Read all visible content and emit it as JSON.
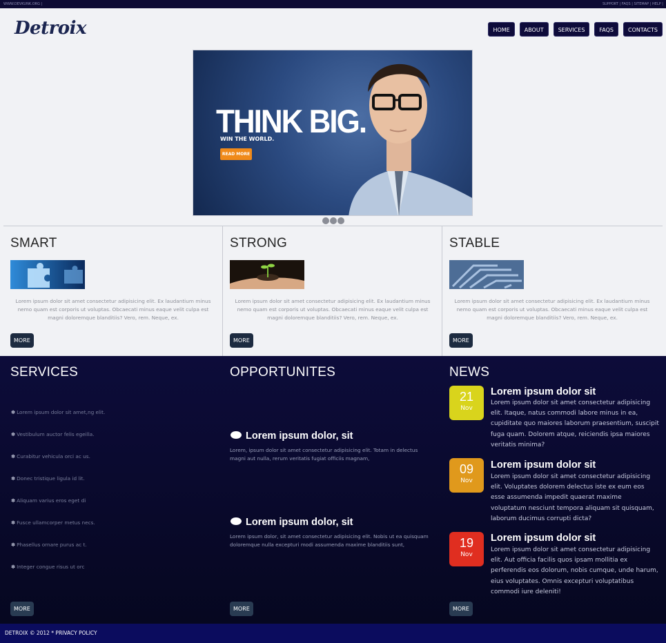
{
  "topbar": {
    "left": "WWW.DEVKUNK.ORG |",
    "right": "SUPPORT | FAQS | SITEMAP | HELP |"
  },
  "brand": {
    "logo": "Detroix"
  },
  "nav": {
    "items": [
      "HOME",
      "ABOUT",
      "SERVICES",
      "FAQS",
      "CONTACTS"
    ]
  },
  "hero": {
    "headline": "THINK BIG.",
    "subline": "WIN THE WORLD.",
    "cta": "READ MORE",
    "slide_count": 3
  },
  "features": [
    {
      "title": "SMART",
      "text": "Lorem ipsum dolor sit amet consectetur adipisicing elit. Ex laudantium minus nemo quam est corporis ut voluptas. Obcaecati minus eaque velit culpa est magni doloremque blanditiis? Vero, rem. Neque, ex.",
      "button": "MORE",
      "image_icon": "puzzle-image"
    },
    {
      "title": "STRONG",
      "text": "Lorem ipsum dolor sit amet consectetur adipisicing elit. Ex laudantium minus nemo quam est corporis ut voluptas. Obcaecati minus eaque velit culpa est magni doloremque blanditiis? Vero, rem. Neque, ex.",
      "button": "MORE",
      "image_icon": "sprout-hand-image"
    },
    {
      "title": "STABLE",
      "text": "Lorem ipsum dolor sit amet consectetur adipisicing elit. Ex laudantium minus nemo quam est corporis ut voluptas. Obcaecati minus eaque velit culpa est magni doloremque blanditiis? Vero, rem. Neque, ex.",
      "button": "MORE",
      "image_icon": "maze-image"
    }
  ],
  "services": {
    "title": "SERVICES",
    "items": [
      "Lorem ipsum dolor sit amet,ng elit.",
      "Vestibulum auctor felis egeilla.",
      "Curabitur vehicula orci ac us.",
      "Donec tristique ligula id lit.",
      "Aliquam varius eros eget di",
      "Fusce ullamcorper metus necs.",
      "Phasellus ornare purus ac t.",
      "Integer congue risus ut orc"
    ],
    "button": "MORE"
  },
  "opportunities": {
    "title": "OPPORTUNITES",
    "items": [
      {
        "title": "Lorem ipsum dolor, sit",
        "text": "Lorem, ipsum dolor sit amet consectetur adipisicing elit. Totam in delectus magni aut nulla, rerum veritatis fugiat officiis magnam,"
      },
      {
        "title": "Lorem ipsum dolor, sit",
        "text": "Lorem ipsum dolor, sit amet consectetur adipisicing elit. Nobis ut ea quisquam doloremque nulla excepturi modi assumenda maxime blanditiis sunt,"
      }
    ],
    "button": "MORE"
  },
  "news": {
    "title": "NEWS",
    "items": [
      {
        "day": "21",
        "month": "Nov",
        "color": "#d9d41c",
        "title": "Lorem ipsum dolor sit",
        "text": "Lorem ipsum dolor sit amet consectetur adipisicing elit. Itaque, natus commodi labore minus in ea, cupiditate quo maiores laborum praesentium, suscipit fuga quam. Dolorem atque, reiciendis ipsa maiores veritatis minima?"
      },
      {
        "day": "09",
        "month": "Nov",
        "color": "#e0991c",
        "title": "Lorem ipsum dolor sit",
        "text": "Lorem ipsum dolor sit amet consectetur adipisicing elit. Voluptates dolorem delectus iste ex eum eos esse assumenda impedit quaerat maxime voluptatum nesciunt tempora aliquam sit quisquam, laborum ducimus corrupti dicta?"
      },
      {
        "day": "19",
        "month": "Nov",
        "color": "#e02e20",
        "title": "Lorem ipsum dolor sit",
        "text": "Lorem ipsum dolor sit amet consectetur adipisicing elit. Aut officia facilis quos ipsam mollitia ex perferendis eos dolorum, nobis cumque, unde harum, eius voluptates. Omnis excepturi voluptatibus commodi iure deleniti!"
      }
    ],
    "button": "MORE"
  },
  "footer": {
    "text": "DETROIX © 2012 * PRIVACY POLICY"
  }
}
